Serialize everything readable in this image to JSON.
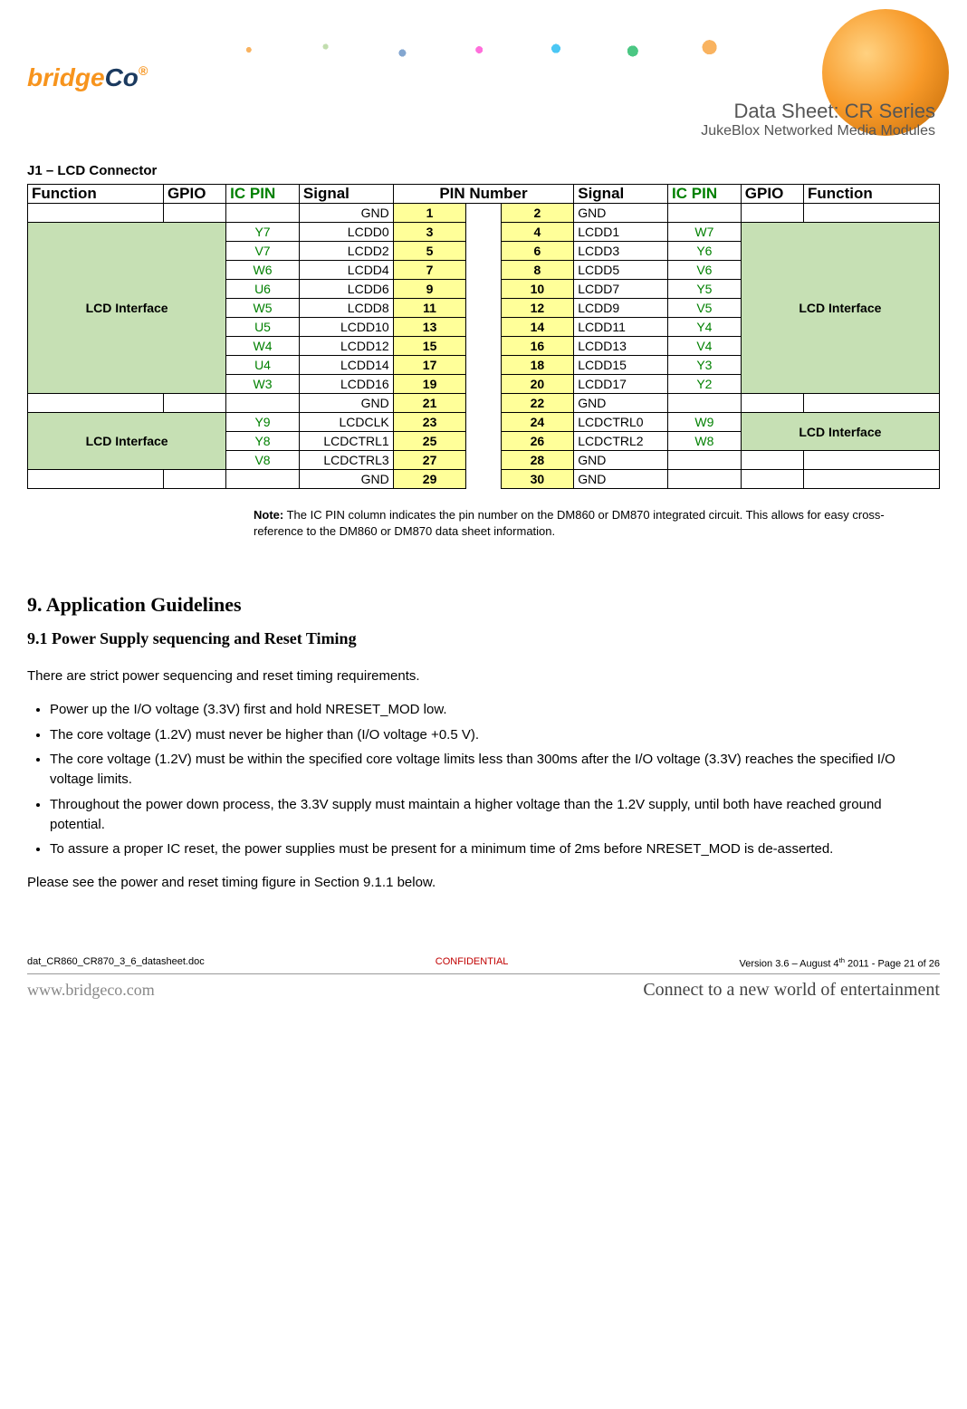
{
  "header": {
    "logo_part1": "bridge",
    "logo_part2": "Co",
    "title1": "Data Sheet: CR Series",
    "title2": "JukeBlox Networked Media Modules"
  },
  "conn_section_title": "J1 – LCD Connector",
  "conn_headers": {
    "function_l": "Function",
    "gpio_l": "GPIO",
    "icpin_l": "IC PIN",
    "signal_l": "Signal",
    "pinnum": "PIN Number",
    "signal_r": "Signal",
    "icpin_r": "IC PIN",
    "gpio_r": "GPIO",
    "function_r": "Function"
  },
  "conn_rows": [
    {
      "fn_l": "",
      "gpio_l": "",
      "ic_l": "",
      "sig_l": "GND",
      "pl": "1",
      "pr": "2",
      "sig_r": "GND",
      "ic_r": "",
      "gpio_r": "",
      "fn_r": "",
      "grp": "g0"
    },
    {
      "fn_l": "LCD Interface",
      "gpio_l": "",
      "ic_l": "Y7",
      "sig_l": "LCDD0",
      "pl": "3",
      "pr": "4",
      "sig_r": "LCDD1",
      "ic_r": "W7",
      "gpio_r": "",
      "fn_r": "LCD Interface",
      "grp": "g1"
    },
    {
      "fn_l": "",
      "gpio_l": "",
      "ic_l": "V7",
      "sig_l": "LCDD2",
      "pl": "5",
      "pr": "6",
      "sig_r": "LCDD3",
      "ic_r": "Y6",
      "gpio_r": "",
      "fn_r": "",
      "grp": "g1"
    },
    {
      "fn_l": "",
      "gpio_l": "",
      "ic_l": "W6",
      "sig_l": "LCDD4",
      "pl": "7",
      "pr": "8",
      "sig_r": "LCDD5",
      "ic_r": "V6",
      "gpio_r": "",
      "fn_r": "",
      "grp": "g1"
    },
    {
      "fn_l": "",
      "gpio_l": "",
      "ic_l": "U6",
      "sig_l": "LCDD6",
      "pl": "9",
      "pr": "10",
      "sig_r": "LCDD7",
      "ic_r": "Y5",
      "gpio_r": "",
      "fn_r": "",
      "grp": "g1"
    },
    {
      "fn_l": "",
      "gpio_l": "",
      "ic_l": "W5",
      "sig_l": "LCDD8",
      "pl": "11",
      "pr": "12",
      "sig_r": "LCDD9",
      "ic_r": "V5",
      "gpio_r": "",
      "fn_r": "",
      "grp": "g1"
    },
    {
      "fn_l": "",
      "gpio_l": "",
      "ic_l": "U5",
      "sig_l": "LCDD10",
      "pl": "13",
      "pr": "14",
      "sig_r": "LCDD11",
      "ic_r": "Y4",
      "gpio_r": "",
      "fn_r": "",
      "grp": "g1"
    },
    {
      "fn_l": "",
      "gpio_l": "",
      "ic_l": "W4",
      "sig_l": "LCDD12",
      "pl": "15",
      "pr": "16",
      "sig_r": "LCDD13",
      "ic_r": "V4",
      "gpio_r": "",
      "fn_r": "",
      "grp": "g1"
    },
    {
      "fn_l": "",
      "gpio_l": "",
      "ic_l": "U4",
      "sig_l": "LCDD14",
      "pl": "17",
      "pr": "18",
      "sig_r": "LCDD15",
      "ic_r": "Y3",
      "gpio_r": "",
      "fn_r": "",
      "grp": "g1"
    },
    {
      "fn_l": "",
      "gpio_l": "",
      "ic_l": "W3",
      "sig_l": "LCDD16",
      "pl": "19",
      "pr": "20",
      "sig_r": "LCDD17",
      "ic_r": "Y2",
      "gpio_r": "",
      "fn_r": "",
      "grp": "g1"
    },
    {
      "fn_l": "",
      "gpio_l": "",
      "ic_l": "",
      "sig_l": "GND",
      "pl": "21",
      "pr": "22",
      "sig_r": "GND",
      "ic_r": "",
      "gpio_r": "",
      "fn_r": "",
      "grp": "g2"
    },
    {
      "fn_l": "LCD Interface",
      "gpio_l": "",
      "ic_l": "Y9",
      "sig_l": "LCDCLK",
      "pl": "23",
      "pr": "24",
      "sig_r": "LCDCTRL0",
      "ic_r": "W9",
      "gpio_r": "",
      "fn_r": "LCD Interface",
      "grp": "g3"
    },
    {
      "fn_l": "",
      "gpio_l": "",
      "ic_l": "Y8",
      "sig_l": "LCDCTRL1",
      "pl": "25",
      "pr": "26",
      "sig_r": "LCDCTRL2",
      "ic_r": "W8",
      "gpio_r": "",
      "fn_r": "",
      "grp": "g3"
    },
    {
      "fn_l": "",
      "gpio_l": "",
      "ic_l": "V8",
      "sig_l": "LCDCTRL3",
      "pl": "27",
      "pr": "28",
      "sig_r": "GND",
      "ic_r": "",
      "gpio_r": "",
      "fn_r": "",
      "grp": "g4"
    },
    {
      "fn_l": "",
      "gpio_l": "",
      "ic_l": "",
      "sig_l": "GND",
      "pl": "29",
      "pr": "30",
      "sig_r": "GND",
      "ic_r": "",
      "gpio_r": "",
      "fn_r": "",
      "grp": "g5"
    }
  ],
  "note": {
    "label": "Note:",
    "text": " The IC PIN column indicates the pin number on the DM860 or DM870 integrated circuit. This allows for easy cross-reference to the DM860 or DM870 data sheet information."
  },
  "h2": "9. Application Guidelines",
  "h3": "9.1 Power Supply sequencing and Reset Timing",
  "para1": "There are strict power sequencing and reset timing requirements.",
  "bullets": [
    "Power up the I/O voltage (3.3V) first and hold NRESET_MOD low.",
    "The core voltage (1.2V) must never be higher than (I/O voltage +0.5 V).",
    "The core voltage (1.2V) must be within the specified core voltage limits less than 300ms after the I/O voltage (3.3V) reaches the specified I/O voltage limits.",
    "Throughout the power down process, the 3.3V supply must maintain a higher voltage than the 1.2V supply, until both have reached ground potential.",
    "To assure a proper IC reset, the power supplies must be present for a minimum time of 2ms before NRESET_MOD is de-asserted."
  ],
  "para2": "Please see the power and reset timing figure in Section 9.1.1 below.",
  "footer": {
    "left": "dat_CR860_CR870_3_6_datasheet.doc",
    "center": "CONFIDENTIAL",
    "right_pre": "Version 3.6 – August 4",
    "right_sup": "th",
    "right_post": " 2011 - Page 21 of 26",
    "url": "www.bridgeco.com",
    "slogan": "Connect to a new world of entertainment"
  }
}
